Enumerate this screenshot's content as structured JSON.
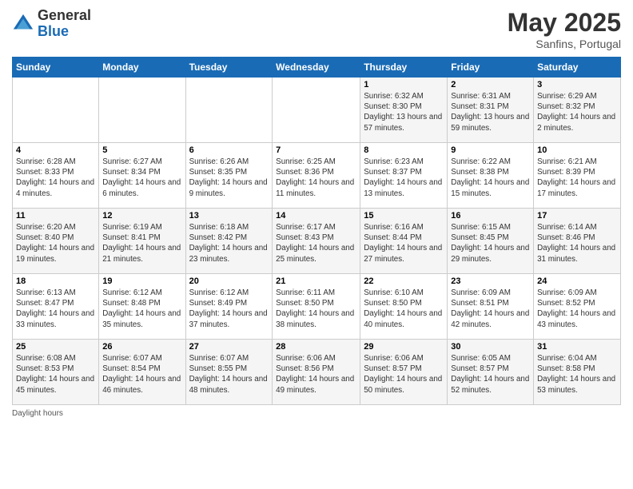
{
  "header": {
    "logo_general": "General",
    "logo_blue": "Blue",
    "month_title": "May 2025",
    "location": "Sanfins, Portugal"
  },
  "days_of_week": [
    "Sunday",
    "Monday",
    "Tuesday",
    "Wednesday",
    "Thursday",
    "Friday",
    "Saturday"
  ],
  "footer": {
    "daylight_label": "Daylight hours"
  },
  "weeks": [
    [
      {
        "day": "",
        "info": ""
      },
      {
        "day": "",
        "info": ""
      },
      {
        "day": "",
        "info": ""
      },
      {
        "day": "",
        "info": ""
      },
      {
        "day": "1",
        "info": "Sunrise: 6:32 AM\nSunset: 8:30 PM\nDaylight: 13 hours and 57 minutes."
      },
      {
        "day": "2",
        "info": "Sunrise: 6:31 AM\nSunset: 8:31 PM\nDaylight: 13 hours and 59 minutes."
      },
      {
        "day": "3",
        "info": "Sunrise: 6:29 AM\nSunset: 8:32 PM\nDaylight: 14 hours and 2 minutes."
      }
    ],
    [
      {
        "day": "4",
        "info": "Sunrise: 6:28 AM\nSunset: 8:33 PM\nDaylight: 14 hours and 4 minutes."
      },
      {
        "day": "5",
        "info": "Sunrise: 6:27 AM\nSunset: 8:34 PM\nDaylight: 14 hours and 6 minutes."
      },
      {
        "day": "6",
        "info": "Sunrise: 6:26 AM\nSunset: 8:35 PM\nDaylight: 14 hours and 9 minutes."
      },
      {
        "day": "7",
        "info": "Sunrise: 6:25 AM\nSunset: 8:36 PM\nDaylight: 14 hours and 11 minutes."
      },
      {
        "day": "8",
        "info": "Sunrise: 6:23 AM\nSunset: 8:37 PM\nDaylight: 14 hours and 13 minutes."
      },
      {
        "day": "9",
        "info": "Sunrise: 6:22 AM\nSunset: 8:38 PM\nDaylight: 14 hours and 15 minutes."
      },
      {
        "day": "10",
        "info": "Sunrise: 6:21 AM\nSunset: 8:39 PM\nDaylight: 14 hours and 17 minutes."
      }
    ],
    [
      {
        "day": "11",
        "info": "Sunrise: 6:20 AM\nSunset: 8:40 PM\nDaylight: 14 hours and 19 minutes."
      },
      {
        "day": "12",
        "info": "Sunrise: 6:19 AM\nSunset: 8:41 PM\nDaylight: 14 hours and 21 minutes."
      },
      {
        "day": "13",
        "info": "Sunrise: 6:18 AM\nSunset: 8:42 PM\nDaylight: 14 hours and 23 minutes."
      },
      {
        "day": "14",
        "info": "Sunrise: 6:17 AM\nSunset: 8:43 PM\nDaylight: 14 hours and 25 minutes."
      },
      {
        "day": "15",
        "info": "Sunrise: 6:16 AM\nSunset: 8:44 PM\nDaylight: 14 hours and 27 minutes."
      },
      {
        "day": "16",
        "info": "Sunrise: 6:15 AM\nSunset: 8:45 PM\nDaylight: 14 hours and 29 minutes."
      },
      {
        "day": "17",
        "info": "Sunrise: 6:14 AM\nSunset: 8:46 PM\nDaylight: 14 hours and 31 minutes."
      }
    ],
    [
      {
        "day": "18",
        "info": "Sunrise: 6:13 AM\nSunset: 8:47 PM\nDaylight: 14 hours and 33 minutes."
      },
      {
        "day": "19",
        "info": "Sunrise: 6:12 AM\nSunset: 8:48 PM\nDaylight: 14 hours and 35 minutes."
      },
      {
        "day": "20",
        "info": "Sunrise: 6:12 AM\nSunset: 8:49 PM\nDaylight: 14 hours and 37 minutes."
      },
      {
        "day": "21",
        "info": "Sunrise: 6:11 AM\nSunset: 8:50 PM\nDaylight: 14 hours and 38 minutes."
      },
      {
        "day": "22",
        "info": "Sunrise: 6:10 AM\nSunset: 8:50 PM\nDaylight: 14 hours and 40 minutes."
      },
      {
        "day": "23",
        "info": "Sunrise: 6:09 AM\nSunset: 8:51 PM\nDaylight: 14 hours and 42 minutes."
      },
      {
        "day": "24",
        "info": "Sunrise: 6:09 AM\nSunset: 8:52 PM\nDaylight: 14 hours and 43 minutes."
      }
    ],
    [
      {
        "day": "25",
        "info": "Sunrise: 6:08 AM\nSunset: 8:53 PM\nDaylight: 14 hours and 45 minutes."
      },
      {
        "day": "26",
        "info": "Sunrise: 6:07 AM\nSunset: 8:54 PM\nDaylight: 14 hours and 46 minutes."
      },
      {
        "day": "27",
        "info": "Sunrise: 6:07 AM\nSunset: 8:55 PM\nDaylight: 14 hours and 48 minutes."
      },
      {
        "day": "28",
        "info": "Sunrise: 6:06 AM\nSunset: 8:56 PM\nDaylight: 14 hours and 49 minutes."
      },
      {
        "day": "29",
        "info": "Sunrise: 6:06 AM\nSunset: 8:57 PM\nDaylight: 14 hours and 50 minutes."
      },
      {
        "day": "30",
        "info": "Sunrise: 6:05 AM\nSunset: 8:57 PM\nDaylight: 14 hours and 52 minutes."
      },
      {
        "day": "31",
        "info": "Sunrise: 6:04 AM\nSunset: 8:58 PM\nDaylight: 14 hours and 53 minutes."
      }
    ]
  ]
}
